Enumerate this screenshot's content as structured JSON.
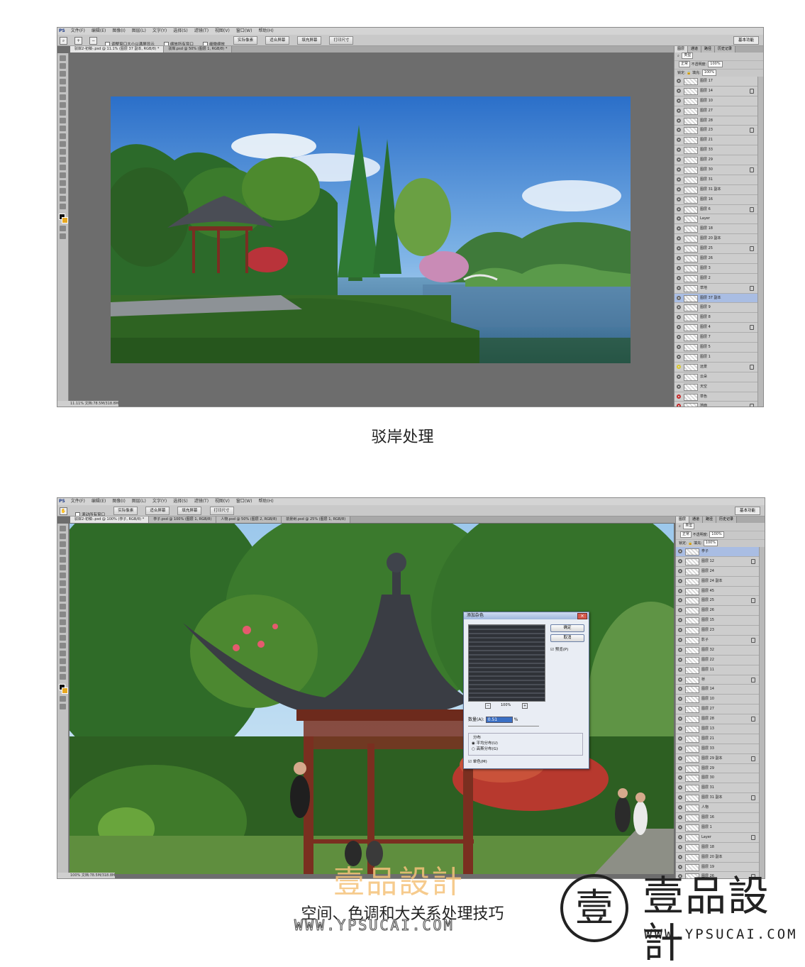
{
  "colors": {
    "ps_gray": "#6d6d6d",
    "panel": "#c8c8c8",
    "selected_layer": "#a9bde3",
    "watermark_orange": "#f5c27a"
  },
  "screenshot1": {
    "menu": [
      "PS",
      "文件(F)",
      "编辑(E)",
      "图像(I)",
      "图层(L)",
      "文字(Y)",
      "选择(S)",
      "滤镜(T)",
      "视图(V)",
      "窗口(W)",
      "帮助(H)"
    ],
    "options": {
      "check1": "调整窗口大小以满屏显示",
      "check2": "缩放所有窗口",
      "check3": "细微缩放",
      "btn1": "实际像素",
      "btn2": "适合屏幕",
      "btn3": "填充屏幕",
      "btn4": "打印尺寸",
      "workspace": "基本功能"
    },
    "tabs": [
      "驳岸2-初稿-.psd @ 11.1% (图层 37 副本, RGB/8) *",
      "驳岸.psd @ 50% (图层 1, RGB/8) *"
    ],
    "panel_tabs": [
      "图层",
      "通道",
      "路径",
      "历史记录"
    ],
    "blend_mode": "正常",
    "opacity_label": "不透明度:",
    "opacity": "100%",
    "lock_label": "锁定:",
    "fill_label": "填充:",
    "fill": "100%",
    "kind": "类型",
    "layers": [
      {
        "name": "图层 17"
      },
      {
        "name": "图层 14"
      },
      {
        "name": "图层 10"
      },
      {
        "name": "图层 27"
      },
      {
        "name": "图层 28"
      },
      {
        "name": "图层 23"
      },
      {
        "name": "图层 21"
      },
      {
        "name": "图层 33"
      },
      {
        "name": "图层 29"
      },
      {
        "name": "图层 30"
      },
      {
        "name": "图层 31"
      },
      {
        "name": "图层 31 副本"
      },
      {
        "name": "图层 16"
      },
      {
        "name": "图层 6"
      },
      {
        "name": "Layer"
      },
      {
        "name": "图层 18"
      },
      {
        "name": "图层 20 副本"
      },
      {
        "name": "图层 25"
      },
      {
        "name": "图层 26"
      },
      {
        "name": "图层 3"
      },
      {
        "name": "图层 2"
      },
      {
        "name": "草地"
      },
      {
        "name": "图层 37 副本",
        "selected": true
      },
      {
        "name": "图层 9"
      },
      {
        "name": "图层 8"
      },
      {
        "name": "图层 4"
      },
      {
        "name": "图层 7"
      },
      {
        "name": "图层 5"
      },
      {
        "name": "图层 1"
      },
      {
        "name": "远景"
      },
      {
        "name": "云朵"
      },
      {
        "name": "天空"
      },
      {
        "name": "草色"
      },
      {
        "name": "地面"
      }
    ],
    "status": "11.11%   文档:78.5M/318.8M",
    "caption": "驳岸处理"
  },
  "screenshot2": {
    "menu": [
      "PS",
      "文件(F)",
      "编辑(E)",
      "图像(I)",
      "图层(L)",
      "文字(Y)",
      "选择(S)",
      "滤镜(T)",
      "视图(V)",
      "窗口(W)",
      "帮助(H)"
    ],
    "options": {
      "check1": "滚动所有窗口",
      "btn1": "实际像素",
      "btn2": "适合屏幕",
      "btn3": "填充屏幕",
      "btn4": "打印尺寸",
      "workspace": "基本功能"
    },
    "tabs": [
      "驳岸2-初稿-.psd @ 100% (亭子, RGB/8) *",
      "亭子.psd @ 100% (图层 1, RGB/8)",
      "人物.psd @ 50% (图层 2, RGB/8)",
      "前景树.psd @ 25% (图层 1, RGB/8)"
    ],
    "panel_tabs": [
      "图层",
      "通道",
      "路径",
      "历史记录"
    ],
    "blend_mode": "正常",
    "opacity_label": "不透明度:",
    "opacity": "100%",
    "lock_label": "锁定:",
    "fill_label": "填充:",
    "fill": "100%",
    "kind": "类型",
    "layers": [
      {
        "name": "亭子",
        "selected": true
      },
      {
        "name": "图层 12"
      },
      {
        "name": "图层 24"
      },
      {
        "name": "图层 24 副本"
      },
      {
        "name": "图层 45"
      },
      {
        "name": "图层 25"
      },
      {
        "name": "图层 26"
      },
      {
        "name": "图层 15"
      },
      {
        "name": "图层 23"
      },
      {
        "name": "影子"
      },
      {
        "name": "图层 32"
      },
      {
        "name": "图层 22"
      },
      {
        "name": "图层 11"
      },
      {
        "name": "桥"
      },
      {
        "name": "图层 14"
      },
      {
        "name": "图层 10"
      },
      {
        "name": "图层 27"
      },
      {
        "name": "图层 28"
      },
      {
        "name": "图层 13"
      },
      {
        "name": "图层 21"
      },
      {
        "name": "图层 33"
      },
      {
        "name": "图层 29 副本"
      },
      {
        "name": "图层 29"
      },
      {
        "name": "图层 30"
      },
      {
        "name": "图层 31"
      },
      {
        "name": "图层 31 副本"
      },
      {
        "name": "人物"
      },
      {
        "name": "图层 16"
      },
      {
        "name": "图层 1"
      },
      {
        "name": "Layer"
      },
      {
        "name": "图层 18"
      },
      {
        "name": "图层 20 副本"
      },
      {
        "name": "图层 19"
      },
      {
        "name": "图层 26"
      }
    ],
    "status": "100%   文档:78.5M/318.8M",
    "dialog": {
      "title": "添加杂色",
      "ok": "确定",
      "cancel": "取消",
      "preview": "预览(P)",
      "zoom": "100%",
      "amount_label": "数量(A):",
      "amount": "0.51",
      "unit": "%",
      "distribution": "分布",
      "uniform": "平均分布(U)",
      "gaussian": "高斯分布(G)",
      "mono": "单色(M)"
    },
    "caption": "空间、色调和大关系处理技巧"
  },
  "watermark": {
    "center_text": "壹品設計",
    "center_url": "WWW.YPSUCAI.COM",
    "logo_char": "壹",
    "logo_text": "壹品設計",
    "logo_url": "WWW.YPSUCAI.COM"
  }
}
